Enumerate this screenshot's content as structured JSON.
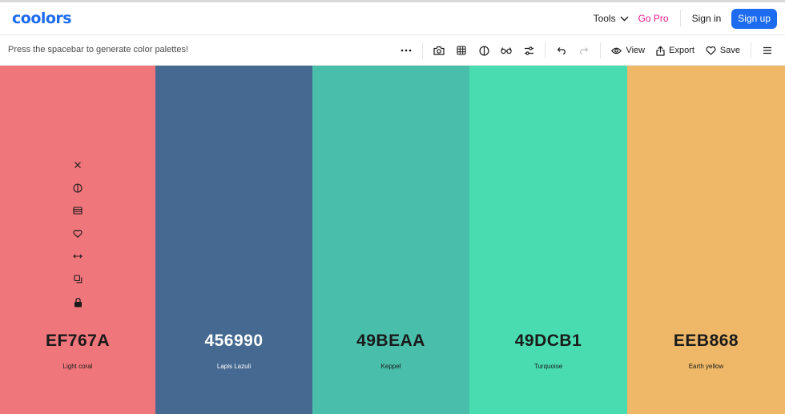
{
  "header": {
    "logo": "coolors",
    "tools_label": "Tools",
    "gopro_label": "Go Pro",
    "signin_label": "Sign in",
    "signup_label": "Sign up"
  },
  "toolbar": {
    "hint": "Press the spacebar to generate color palettes!",
    "view_label": "View",
    "export_label": "Export",
    "save_label": "Save"
  },
  "colors": {
    "brand": "#1d6cf0",
    "gopro": "#e8188e"
  },
  "palette": [
    {
      "hex": "EF767A",
      "name": "Light coral",
      "color": "#EF767A",
      "text_color": "#1a1a1a"
    },
    {
      "hex": "456990",
      "name": "Lapis Lazuli",
      "color": "#456990",
      "text_color": "#ffffff"
    },
    {
      "hex": "49BEAA",
      "name": "Keppel",
      "color": "#49BEAA",
      "text_color": "#1a1a1a"
    },
    {
      "hex": "49DCB1",
      "name": "Turquoise",
      "color": "#49DCB1",
      "text_color": "#1a1a1a"
    },
    {
      "hex": "EEB868",
      "name": "Earth yellow",
      "color": "#EEB868",
      "text_color": "#1a1a1a"
    }
  ],
  "swatch_tools": [
    "close-icon",
    "contrast-icon",
    "shades-icon",
    "heart-icon",
    "drag-icon",
    "copy-icon",
    "lock-icon"
  ]
}
